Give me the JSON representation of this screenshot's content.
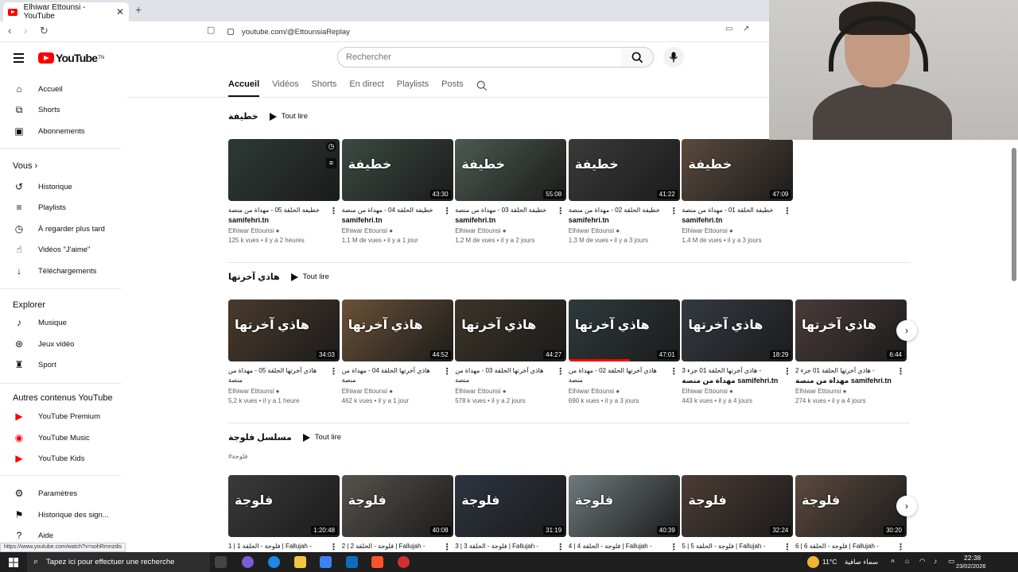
{
  "browser": {
    "tab_title": "Elhiwar Ettounsi - YouTube",
    "tab_close": "✕",
    "new_tab": "+",
    "url": "youtube.com/@EttounsiaReplay",
    "status_url": "https://www.youtube.com/watch?v=sohRmnzdis"
  },
  "header": {
    "logo_text": "YouTube",
    "logo_sup": "TN",
    "search_placeholder": "Rechercher"
  },
  "sidebar": {
    "main": [
      {
        "label": "Accueil"
      },
      {
        "label": "Shorts"
      },
      {
        "label": "Abonnements"
      }
    ],
    "you_heading": "Vous",
    "you_items": [
      {
        "label": "Historique"
      },
      {
        "label": "Playlists"
      },
      {
        "label": "À regarder plus tard"
      },
      {
        "label": "Vidéos \"J'aime\""
      },
      {
        "label": "Téléchargements"
      }
    ],
    "explore_heading": "Explorer",
    "explore_items": [
      {
        "label": "Musique"
      },
      {
        "label": "Jeux vidéo"
      },
      {
        "label": "Sport"
      }
    ],
    "more_heading": "Autres contenus YouTube",
    "more_items": [
      {
        "label": "YouTube Premium"
      },
      {
        "label": "YouTube Music"
      },
      {
        "label": "YouTube Kids"
      }
    ],
    "settings_items": [
      {
        "label": "Paramètres"
      },
      {
        "label": "Historique des sign..."
      },
      {
        "label": "Aide"
      }
    ]
  },
  "channel_tabs": [
    "Accueil",
    "Vidéos",
    "Shorts",
    "En direct",
    "Playlists",
    "Posts"
  ],
  "play_all_label": "Tout lire",
  "shelves": [
    {
      "title": "خطيفة",
      "subtitle": "",
      "videos": [
        {
          "thumb_text": "",
          "duration": "",
          "title": "خطيفة الحلقة 05 - مهداة من منصة",
          "title2": "samifehri.tn",
          "channel": "Elhiwar Ettounsi",
          "meta": "125 k vues • il y a 2 heures",
          "progress": 0
        },
        {
          "thumb_text": "خطيفة",
          "duration": "43:30",
          "title": "خطيفة الحلقة 04 - مهداة من منصة",
          "title2": "samifehri.tn",
          "channel": "Elhiwar Ettounsi",
          "meta": "1,1 M de vues • il y a 1 jour",
          "progress": 0
        },
        {
          "thumb_text": "خطيفة",
          "duration": "55:08",
          "title": "خطيفة الحلقة 03 - مهداة من منصة",
          "title2": "samifehri.tn",
          "channel": "Elhiwar Ettounsi",
          "meta": "1,2 M de vues • il y a 2 jours",
          "progress": 0
        },
        {
          "thumb_text": "خطيفة",
          "duration": "41:22",
          "title": "خطيفة الحلقة 02 - مهداة من منصة",
          "title2": "samifehri.tn",
          "channel": "Elhiwar Ettounsi",
          "meta": "1,3 M de vues • il y a 3 jours",
          "progress": 0
        },
        {
          "thumb_text": "خطيفة",
          "duration": "47:09",
          "title": "خطيفة الحلقة 01 - مهداة من منصة",
          "title2": "samifehri.tn",
          "channel": "Elhiwar Ettounsi",
          "meta": "1,4 M de vues • il y a 3 jours",
          "progress": 0
        }
      ]
    },
    {
      "title": "هاذي آخرتها",
      "subtitle": "",
      "videos": [
        {
          "thumb_text": "هاذي آخرتها",
          "duration": "34:03",
          "title": "هاذي آخرتها الحلقة 05 - مهداة من منصة",
          "title2": "samifehri.tn",
          "channel": "Elhiwar Ettounsi",
          "meta": "5,2 k vues • il y a 1 heure",
          "progress": 0
        },
        {
          "thumb_text": "هاذي آخرتها",
          "duration": "44:52",
          "title": "هاذي آخرتها الحلقة 04 - مهداة من منصة",
          "title2": "samifehri.tn",
          "channel": "Elhiwar Ettounsi",
          "meta": "462 k vues • il y a 1 jour",
          "progress": 0
        },
        {
          "thumb_text": "هاذي آخرتها",
          "duration": "44:27",
          "title": "هاذي آخرتها الحلقة 03 - مهداة من منصة",
          "title2": "samifehri.tn",
          "channel": "Elhiwar Ettounsi",
          "meta": "578 k vues • il y a 2 jours",
          "progress": 0
        },
        {
          "thumb_text": "هاذي آخرتها",
          "duration": "47:01",
          "title": "هاذي آخرتها الحلقة 02 - مهداة من منصة",
          "title2": "samifehri.tn",
          "channel": "Elhiwar Ettounsi",
          "meta": "690 k vues • il y a 3 jours",
          "progress": 0.55
        },
        {
          "thumb_text": "هاذي آخرتها",
          "duration": "18:29",
          "title": "هاذي آخرتها الحلقة 01 جزء 3 -",
          "title2": "مهداة من منصة samifehri.tn",
          "channel": "Elhiwar Ettounsi",
          "meta": "443 k vues • il y a 4 jours",
          "progress": 0
        },
        {
          "thumb_text": "هاذي آخرتها",
          "duration": "6:44",
          "title": "هاذي آخرتها الحلقة 01 جزء 2 -",
          "title2": "مهداة من منصة samifehri.tn",
          "channel": "Elhiwar Ettounsi",
          "meta": "274 k vues • il y a 4 jours",
          "progress": 0
        }
      ]
    },
    {
      "title": "مسلسل فلوجة",
      "subtitle": "#فلوجة",
      "videos": [
        {
          "thumb_text": "فلوجة",
          "duration": "1:20:48",
          "title": "1 | فلوجة - الحلقة 1 | Fallujah -",
          "title2": "",
          "channel": "",
          "meta": "",
          "progress": 0
        },
        {
          "thumb_text": "فلوجة",
          "duration": "40:08",
          "title": "2 | فلوجة - الحلقة 2 | Fallujah -",
          "title2": "",
          "channel": "",
          "meta": "",
          "progress": 0
        },
        {
          "thumb_text": "فلوجة",
          "duration": "31:19",
          "title": "3 | فلوجة - الحلقة 3 | Fallujah -",
          "title2": "",
          "channel": "",
          "meta": "",
          "progress": 0
        },
        {
          "thumb_text": "فلوجة",
          "duration": "40:39",
          "title": "4 | فلوجة - الحلقة 4 | Fallujah -",
          "title2": "",
          "channel": "",
          "meta": "",
          "progress": 0
        },
        {
          "thumb_text": "فلوجة",
          "duration": "32:24",
          "title": "5 | فلوجة - الحلقة 5 | Fallujah -",
          "title2": "",
          "channel": "",
          "meta": "",
          "progress": 0
        },
        {
          "thumb_text": "فلوجة",
          "duration": "30:20",
          "title": "6 | فلوجة - الحلقة 6 | Fallujah -",
          "title2": "",
          "channel": "",
          "meta": "",
          "progress": 0
        }
      ]
    }
  ],
  "taskbar": {
    "search_placeholder": "Tapez ici pour effectuer une recherche",
    "weather": "11°C",
    "weather_text": "سماء صافية",
    "time": "22:38",
    "date": "23/02/2026"
  },
  "colors": {
    "accent": "#ff0000",
    "text": "#0f0f0f",
    "muted": "#606060"
  }
}
